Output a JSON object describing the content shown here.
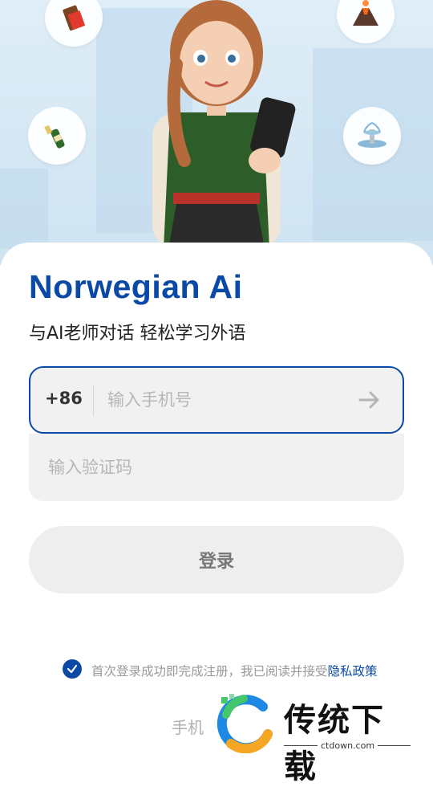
{
  "hero": {
    "bubbles": [
      "chocolate-icon",
      "volcano-icon",
      "champagne-icon",
      "fountain-icon"
    ]
  },
  "app_title": "Norwegian Ai",
  "subtitle": "与AI老师对话 轻松学习外语",
  "phone": {
    "country_code": "+86",
    "placeholder": "输入手机号"
  },
  "code": {
    "placeholder": "输入验证码"
  },
  "login_label": "登录",
  "agreement": {
    "text": "首次登录成功即完成注册，我已阅读并接受",
    "link": "隐私政策"
  },
  "alt_login": "手机",
  "watermark": {
    "brand": "传统下载",
    "url": "ctdown.com"
  },
  "colors": {
    "accent": "#0a4aa6",
    "input_bg": "#f1f1f1",
    "button_bg": "#eeeeee"
  }
}
